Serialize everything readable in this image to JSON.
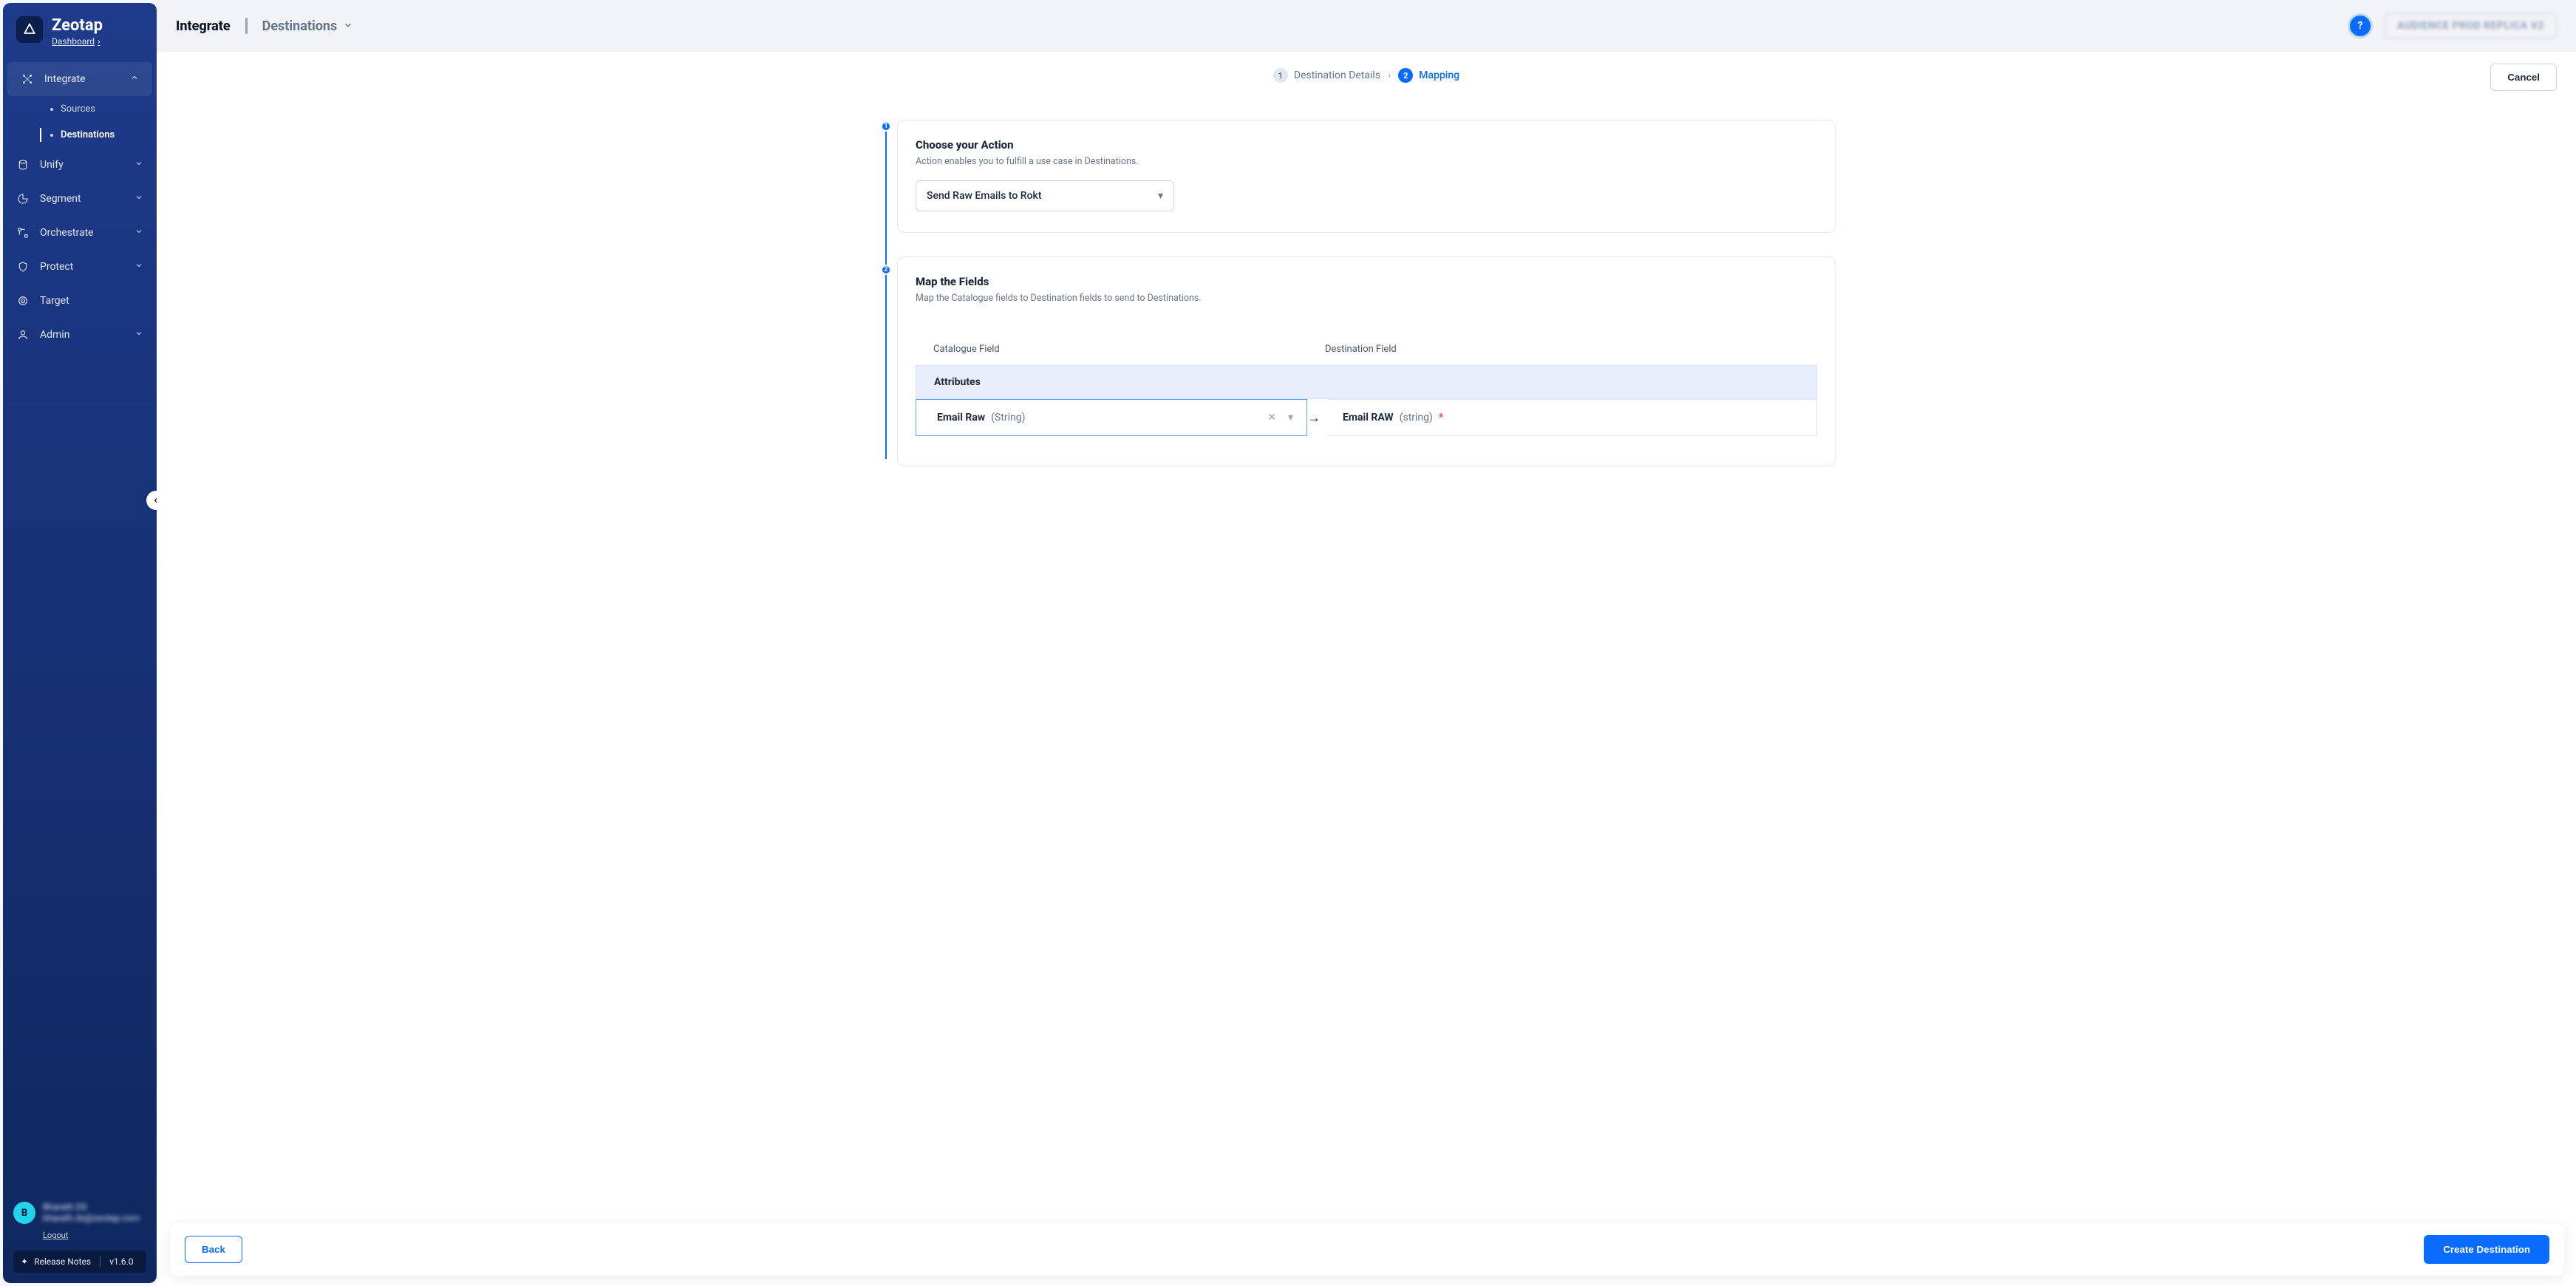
{
  "brand": {
    "name": "Zeotap",
    "dashboard_label": "Dashboard"
  },
  "sidebar": {
    "integrate": "Integrate",
    "sources": "Sources",
    "destinations": "Destinations",
    "unify": "Unify",
    "segment": "Segment",
    "orchestrate": "Orchestrate",
    "protect": "Protect",
    "target": "Target",
    "admin": "Admin"
  },
  "user": {
    "avatar_initial": "B",
    "name": "Bharath DS",
    "email": "bharath.ds@zeotap.com",
    "logout": "Logout"
  },
  "release": {
    "label": "Release Notes",
    "version": "v1.6.0"
  },
  "topbar": {
    "crumb1": "Integrate",
    "crumb2": "Destinations",
    "env": "AUDIENCE PROD REPLICA V2"
  },
  "stepper": {
    "step1_num": "1",
    "step1_label": "Destination Details",
    "step2_num": "2",
    "step2_label": "Mapping",
    "cancel": "Cancel"
  },
  "action_card": {
    "title": "Choose your Action",
    "subtitle": "Action enables you to fulfill a use case in Destinations.",
    "selected": "Send Raw Emails to Rokt",
    "node": "1"
  },
  "map_card": {
    "title": "Map the Fields",
    "subtitle": "Map the Catalogue fields to Destination fields to send to Destinations.",
    "col_a": "Catalogue Field",
    "col_b": "Destination Field",
    "band": "Attributes",
    "row": {
      "cat_name": "Email Raw",
      "cat_type": "(String)",
      "dest_name": "Email RAW",
      "dest_type": "(string)"
    },
    "node": "2"
  },
  "footer": {
    "back": "Back",
    "create": "Create Destination"
  }
}
